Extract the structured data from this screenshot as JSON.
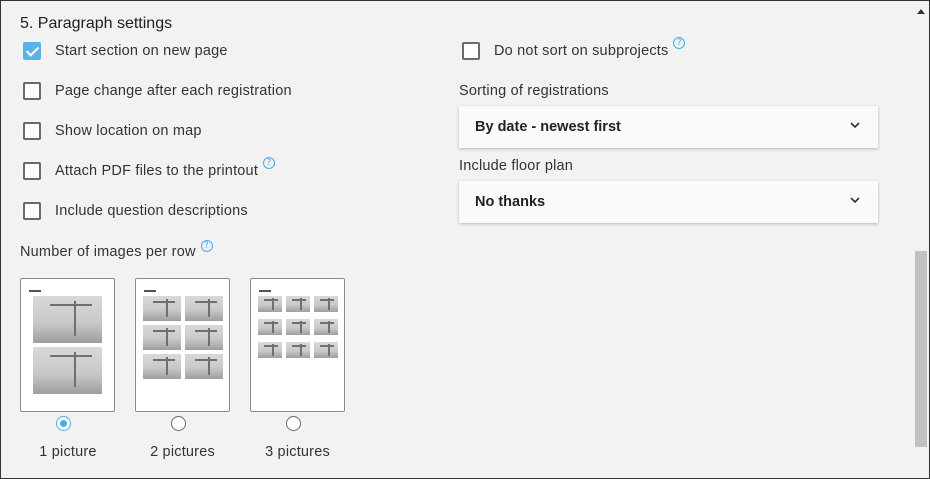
{
  "section": {
    "title": "5. Paragraph settings"
  },
  "checkboxes": {
    "start_section_new_page": {
      "label": "Start section on new page",
      "checked": true
    },
    "page_change_each_registration": {
      "label": "Page change after each registration",
      "checked": false
    },
    "show_location_on_map": {
      "label": "Show location on map",
      "checked": false
    },
    "attach_pdf_files": {
      "label": "Attach PDF files to the printout",
      "checked": false
    },
    "include_question_descriptions": {
      "label": "Include question descriptions",
      "checked": false
    },
    "do_not_sort_subprojects": {
      "label": "Do not sort on subprojects",
      "checked": false
    }
  },
  "help_icon": "?",
  "sorting": {
    "label": "Sorting of registrations",
    "selected": "By date - newest first"
  },
  "floor_plan": {
    "label": "Include floor plan",
    "selected": "No thanks"
  },
  "images_per_row": {
    "label": "Number of images per row",
    "options": [
      {
        "label": "1 picture",
        "selected": true
      },
      {
        "label": "2 pictures",
        "selected": false
      },
      {
        "label": "3 pictures",
        "selected": false
      }
    ]
  },
  "colors": {
    "accent": "#4aaee0",
    "checkbox_checked": "#5ab4e3",
    "background": "#f2f2f2"
  },
  "icons": {
    "help": "help-icon",
    "chevron": "chevron-down-icon",
    "check": "check-icon"
  }
}
